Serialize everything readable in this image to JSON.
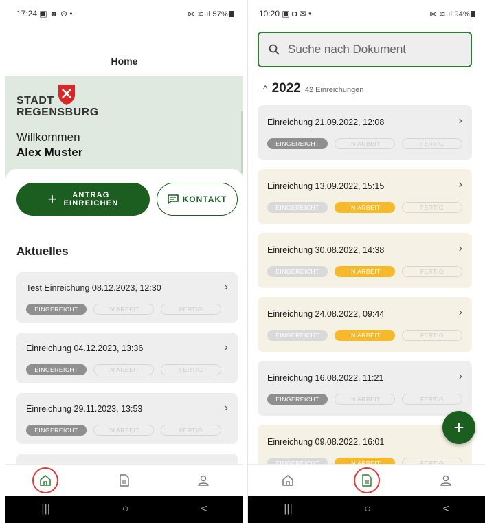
{
  "left": {
    "status": {
      "time": "17:24",
      "icons_left": "▣ ☻ ⊙ •",
      "signal": "⋈ ≋.ıl",
      "battery": "57%"
    },
    "header": {
      "title": "Home"
    },
    "hero": {
      "logo_line1": "STADT",
      "logo_line2": "REGENSBURG",
      "welcome": "Willkommen",
      "username": "Alex Muster"
    },
    "actions": {
      "antrag_plus": "+",
      "antrag_label": "ANTRAG EINREICHEN",
      "kontakt_label": "KONTAKT"
    },
    "section_title": "Aktuelles",
    "cards": [
      {
        "title": "Test Einreichung 08.12.2023, 12:30"
      },
      {
        "title": "Einreichung 04.12.2023, 13:36"
      },
      {
        "title": "Einreichung 29.11.2023, 13:53"
      }
    ],
    "badge_labels": {
      "submitted": "EINGEREICHT",
      "in_progress": "IN ARBEIT",
      "done": "FERTIG"
    }
  },
  "right": {
    "status": {
      "time": "10:20",
      "icons_left": "▣ ◘ ✉ •",
      "signal": "⋈ ≋.ıl",
      "battery": "94%"
    },
    "search": {
      "placeholder": "Suche nach Dokument"
    },
    "year": {
      "caret": "^",
      "value": "2022",
      "count": "42 Einreichungen"
    },
    "cards": [
      {
        "title": "Einreichung 21.09.2022, 12:08",
        "status": "submitted"
      },
      {
        "title": "Einreichung 13.09.2022, 15:15",
        "status": "in_progress"
      },
      {
        "title": "Einreichung 30.08.2022, 14:38",
        "status": "in_progress"
      },
      {
        "title": "Einreichung 24.08.2022, 09:44",
        "status": "in_progress"
      },
      {
        "title": "Einreichung 16.08.2022, 11:21",
        "status": "submitted"
      },
      {
        "title": "Einreichung 09.08.2022, 16:01",
        "status": "in_progress"
      }
    ],
    "fab": "+",
    "badge_labels": {
      "submitted": "EINGEREICHT",
      "in_progress": "IN ARBEIT",
      "done": "FERTIG"
    }
  },
  "nav": {
    "sys_recent": "|||",
    "sys_home": "○",
    "sys_back": "<"
  },
  "colors": {
    "primary": "#1b5e20",
    "hero_bg": "#dfe9df",
    "badge_gray": "#8f8f8f",
    "badge_yellow": "#f6b92b",
    "highlight_ring": "#e53935"
  },
  "icons": {
    "home": "home-icon",
    "document": "document-icon",
    "profile": "profile-icon",
    "search": "search-icon",
    "chat": "chat-icon",
    "chevron": "chevron-right-icon",
    "crest": "crest-icon"
  }
}
